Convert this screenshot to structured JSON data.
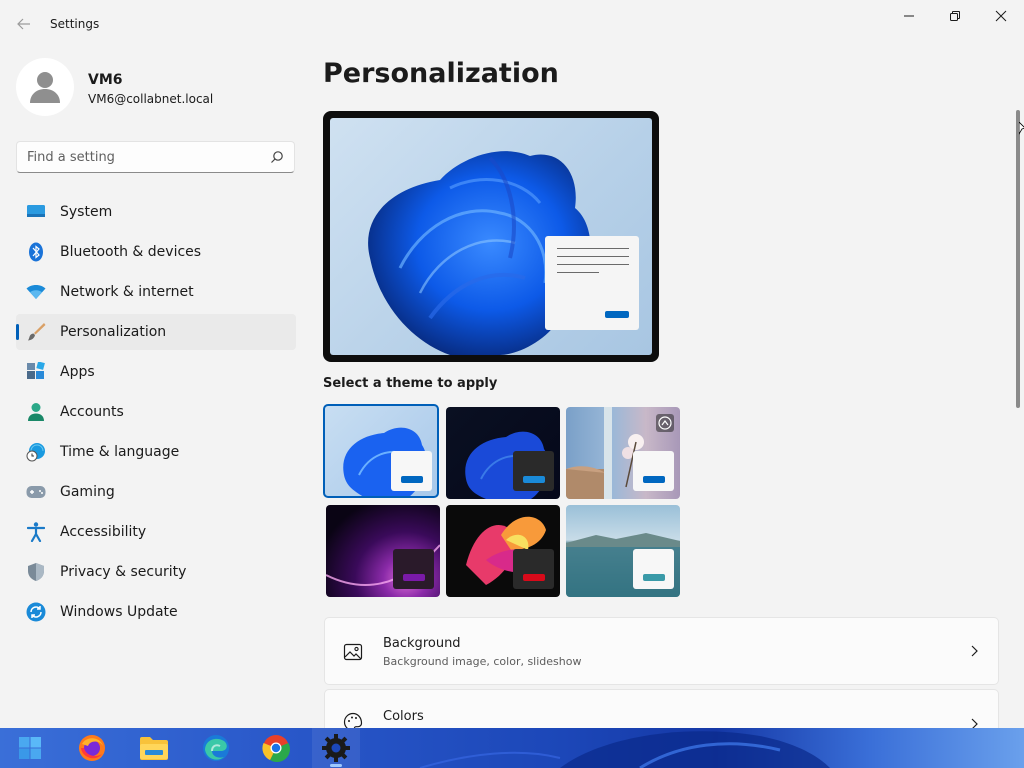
{
  "window": {
    "title": "Settings"
  },
  "user": {
    "name": "VM6",
    "email": "VM6@collabnet.local"
  },
  "search": {
    "placeholder": "Find a setting"
  },
  "nav": {
    "items": [
      {
        "label": "System",
        "icon": "system-icon"
      },
      {
        "label": "Bluetooth & devices",
        "icon": "bluetooth-icon"
      },
      {
        "label": "Network & internet",
        "icon": "wifi-icon"
      },
      {
        "label": "Personalization",
        "icon": "brush-icon",
        "active": true
      },
      {
        "label": "Apps",
        "icon": "apps-icon"
      },
      {
        "label": "Accounts",
        "icon": "person-icon"
      },
      {
        "label": "Time & language",
        "icon": "clock-globe-icon"
      },
      {
        "label": "Gaming",
        "icon": "gamepad-icon"
      },
      {
        "label": "Accessibility",
        "icon": "accessibility-icon"
      },
      {
        "label": "Privacy & security",
        "icon": "shield-icon"
      },
      {
        "label": "Windows Update",
        "icon": "update-icon"
      }
    ]
  },
  "main": {
    "title": "Personalization",
    "theme_label": "Select a theme to apply",
    "themes": [
      {
        "name": "windows-light",
        "selected": true
      },
      {
        "name": "windows-dark"
      },
      {
        "name": "windows-spotlight"
      },
      {
        "name": "glow"
      },
      {
        "name": "captured-motion"
      },
      {
        "name": "flow"
      }
    ],
    "cards": [
      {
        "title": "Background",
        "subtitle": "Background image, color, slideshow",
        "icon": "image-icon"
      },
      {
        "title": "Colors",
        "subtitle": "",
        "icon": "palette-icon"
      }
    ]
  },
  "colors": {
    "accent": "#005fb8",
    "background": "#f3f3f3"
  },
  "taskbar": {
    "items": [
      "start-icon",
      "firefox-icon",
      "file-explorer-icon",
      "edge-icon",
      "chrome-icon",
      "settings-icon"
    ]
  }
}
